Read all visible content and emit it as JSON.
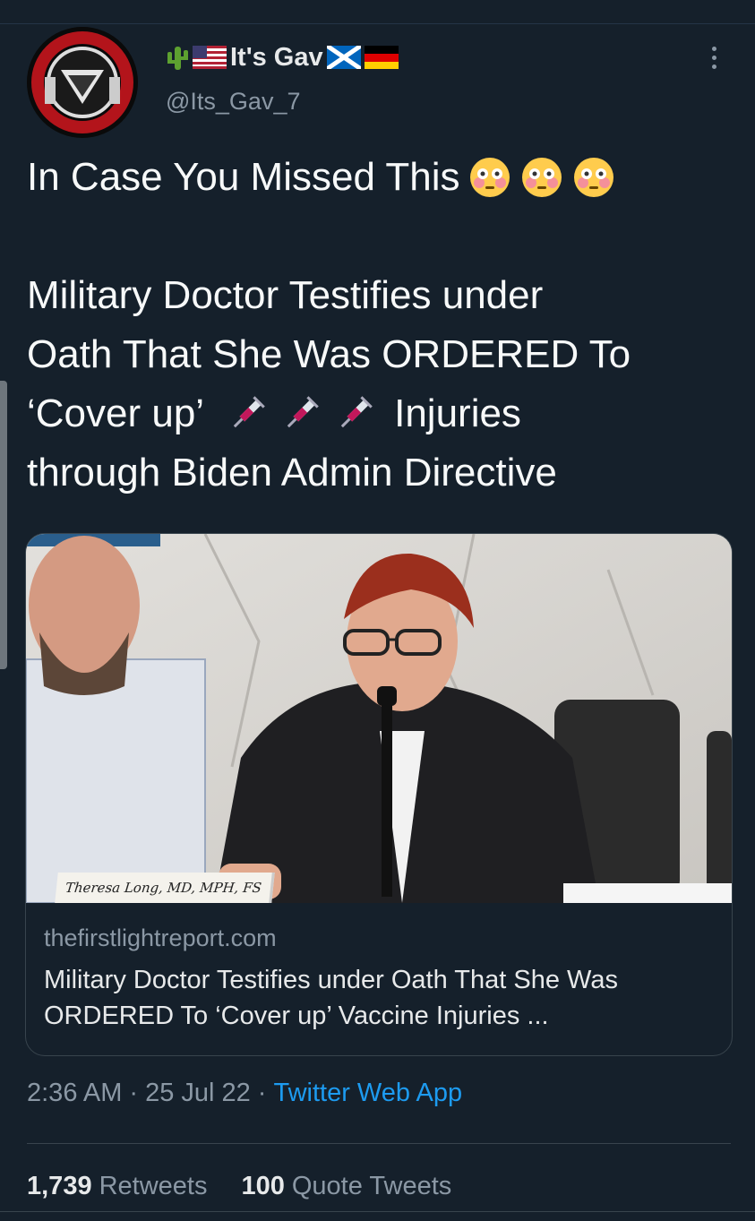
{
  "colors": {
    "background": "#15202b",
    "text": "#e7e9ea",
    "muted": "#8b98a5",
    "link": "#1d9bf0",
    "border": "#38444d"
  },
  "author": {
    "display_name": "It's Gav",
    "name_icons": [
      "cactus-emoji",
      "us-flag-emoji",
      "scotland-flag-emoji",
      "germany-flag-emoji"
    ],
    "handle": "@Its_Gav_7"
  },
  "tweet": {
    "line1": "In Case You Missed This",
    "line1_emoji": "flushed-face-emoji",
    "line2": "Military Doctor Testifies under",
    "line3": "Oath That She Was ORDERED To",
    "line4_before": "‘Cover up’",
    "line4_after": "Injuries",
    "line4_emoji": "syringe-emoji",
    "line5": "through Biden Admin Directive"
  },
  "card": {
    "lower_third": "Theresa Long, MD, MPH, FS",
    "domain": "thefirstlightreport.com",
    "title": "Military Doctor Testifies under Oath That She Was ORDERED To ‘Cover up’ Vaccine Injuries ..."
  },
  "meta": {
    "time": "2:36 AM",
    "sep1": "·",
    "date": "25 Jul 22",
    "sep2": "·",
    "source": "Twitter Web App"
  },
  "stats": {
    "retweets_count": "1,739",
    "retweets_label": "Retweets",
    "quotes_count": "100",
    "quotes_label": "Quote Tweets"
  }
}
